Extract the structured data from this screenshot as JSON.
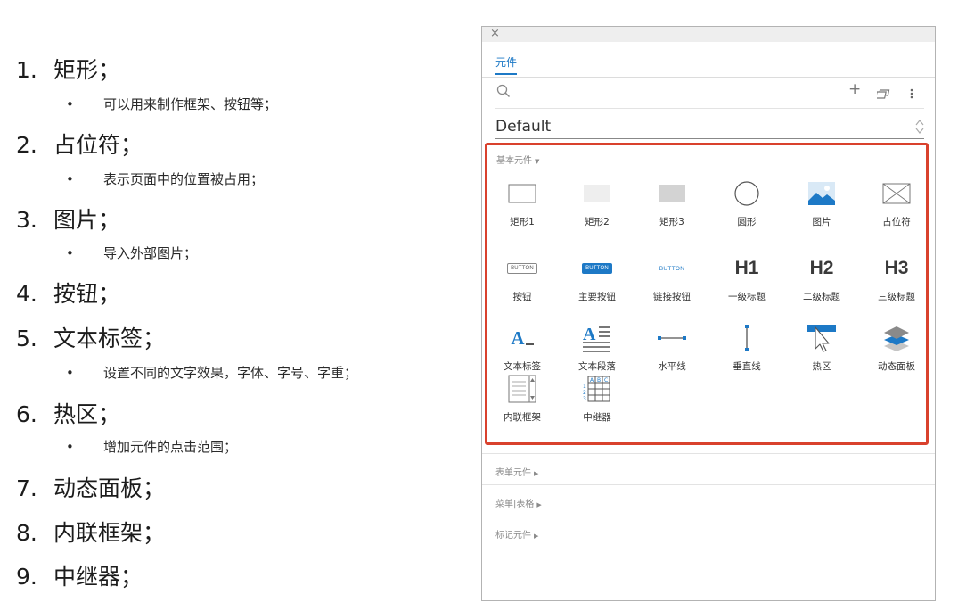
{
  "notes": [
    {
      "num": "1.",
      "title": "矩形；",
      "bullet": "可以用来制作框架、按钮等；"
    },
    {
      "num": "2.",
      "title": "占位符；",
      "bullet": "表示页面中的位置被占用；"
    },
    {
      "num": "3.",
      "title": "图片；",
      "bullet": "导入外部图片；"
    },
    {
      "num": "4.",
      "title": "按钮；"
    },
    {
      "num": "5.",
      "title": "文本标签；",
      "bullet": "设置不同的文字效果，字体、字号、字重；"
    },
    {
      "num": "6.",
      "title": "热区；",
      "bullet": "增加元件的点击范围；"
    },
    {
      "num": "7.",
      "title": "动态面板；"
    },
    {
      "num": "8.",
      "title": "内联框架；"
    },
    {
      "num": "9.",
      "title": "中继器；"
    }
  ],
  "bullet_glyph": "•",
  "panel": {
    "close_glyph": "×",
    "tab_label": "元件",
    "plus_glyph": "+",
    "library_selected": "Default",
    "basic_section_label": "基本元件",
    "section_arrow_open": "▼",
    "section_arrow_closed": "▶",
    "widgets": [
      {
        "label": "矩形1",
        "icon": "rectangle-outline-icon"
      },
      {
        "label": "矩形2",
        "icon": "rectangle-light-gray-icon"
      },
      {
        "label": "矩形3",
        "icon": "rectangle-dark-gray-icon"
      },
      {
        "label": "圆形",
        "icon": "circle-icon"
      },
      {
        "label": "图片",
        "icon": "image-icon"
      },
      {
        "label": "占位符",
        "icon": "placeholder-icon"
      },
      {
        "label": "按钮",
        "icon": "button-icon",
        "icon_text": "BUTTON"
      },
      {
        "label": "主要按钮",
        "icon": "primary-button-icon",
        "icon_text": "BUTTON"
      },
      {
        "label": "链接按钮",
        "icon": "link-button-icon",
        "icon_text": "BUTTON"
      },
      {
        "label": "一级标题",
        "icon": "heading-1-icon",
        "icon_text": "H1"
      },
      {
        "label": "二级标题",
        "icon": "heading-2-icon",
        "icon_text": "H2"
      },
      {
        "label": "三级标题",
        "icon": "heading-3-icon",
        "icon_text": "H3"
      },
      {
        "label": "文本标签",
        "icon": "text-label-icon",
        "icon_text": "A"
      },
      {
        "label": "文本段落",
        "icon": "text-paragraph-icon",
        "icon_text": "A"
      },
      {
        "label": "水平线",
        "icon": "horizontal-line-icon"
      },
      {
        "label": "垂直线",
        "icon": "vertical-line-icon"
      },
      {
        "label": "热区",
        "icon": "hotspot-icon"
      },
      {
        "label": "动态面板",
        "icon": "dynamic-panel-icon"
      },
      {
        "label": "内联框架",
        "icon": "inline-frame-icon"
      },
      {
        "label": "中继器",
        "icon": "repeater-icon",
        "icon_text": [
          "A",
          "B",
          "C",
          "1",
          "2",
          "3"
        ]
      }
    ],
    "collapsed_sections": [
      "表单元件",
      "菜单|表格",
      "标记元件"
    ]
  },
  "colors": {
    "accent": "#1d79c6",
    "highlight_border": "#d9412d"
  }
}
